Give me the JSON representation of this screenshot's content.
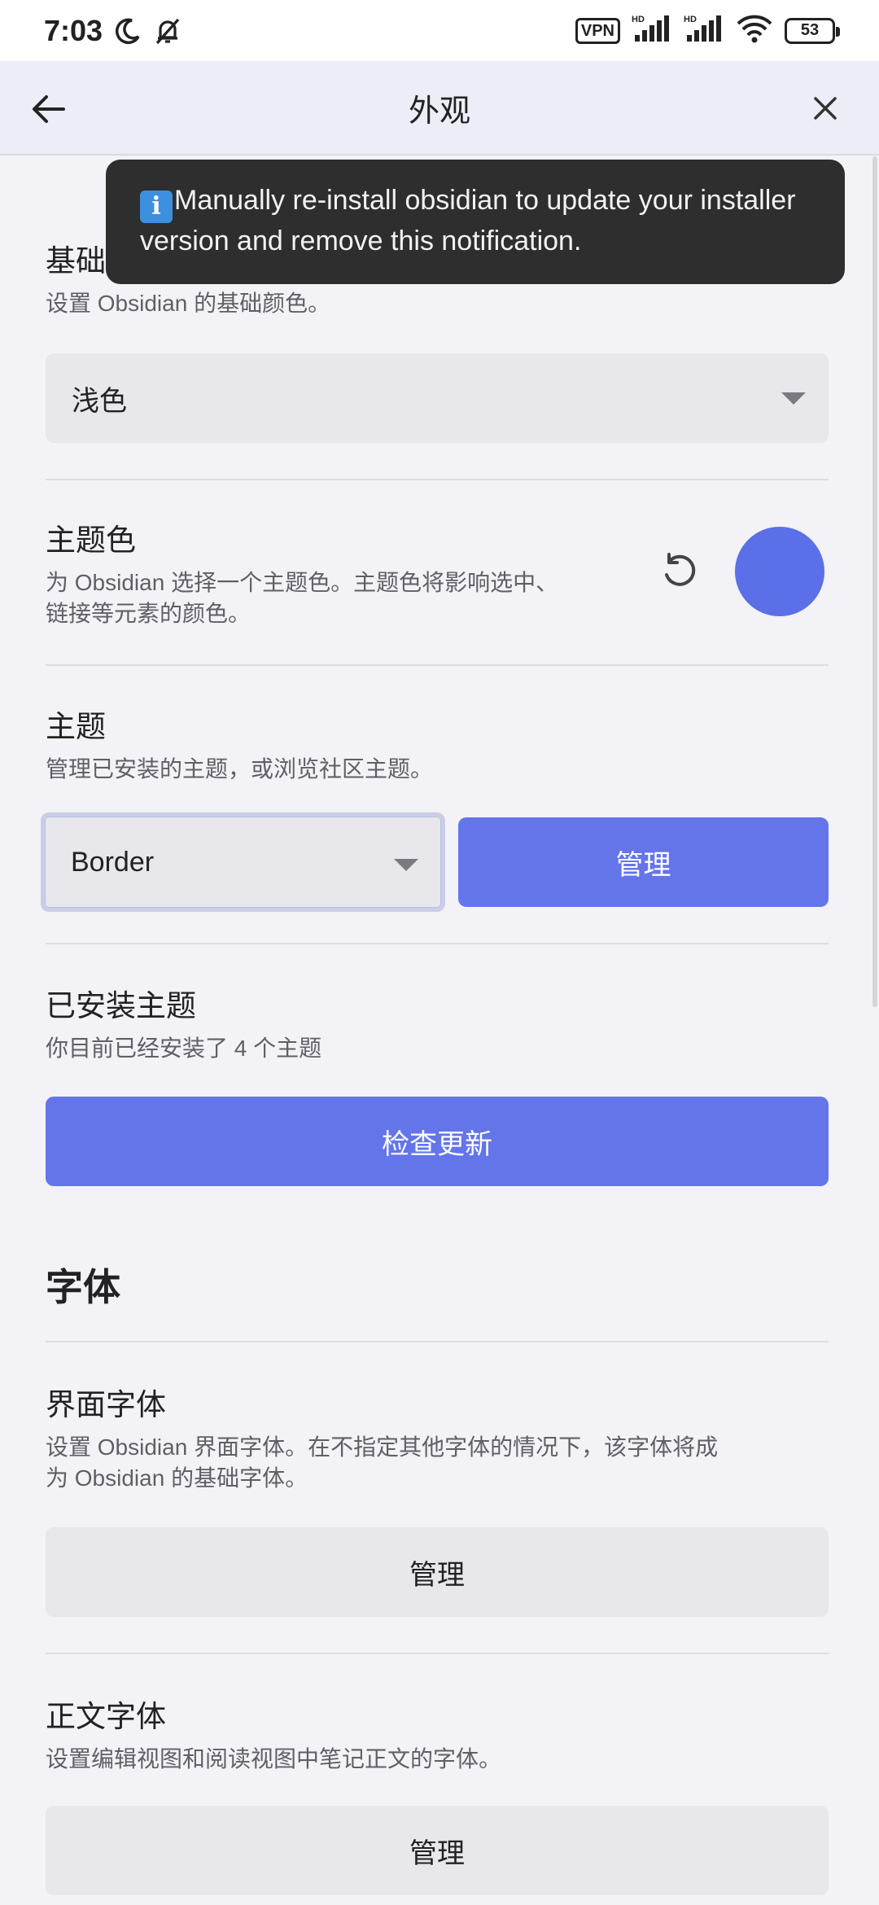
{
  "status_bar": {
    "time": "7:03",
    "vpn_label": "VPN",
    "network_1": "HD",
    "network_2": "HD",
    "battery": "53"
  },
  "header": {
    "title": "外观"
  },
  "toast": {
    "message": "Manually re-install obsidian to update your installer version and remove this notification."
  },
  "settings": {
    "base_color": {
      "name": "基础颜色",
      "desc": "设置 Obsidian 的基础颜色。",
      "selected": "浅色"
    },
    "accent_color": {
      "name": "主题色",
      "desc_line1": "为 Obsidian 选择一个主题色。主题色将影响选中、",
      "desc_line2": "链接等元素的颜色。",
      "color": "#5b6fe8"
    },
    "theme": {
      "name": "主题",
      "desc": "管理已安装的主题，或浏览社区主题。",
      "selected": "Border",
      "manage_label": "管理"
    },
    "installed_themes": {
      "name": "已安装主题",
      "desc": "你目前已经安装了 4 个主题",
      "check_updates_label": "检查更新"
    },
    "fonts_heading": "字体",
    "interface_font": {
      "name": "界面字体",
      "desc_line1": "设置 Obsidian 界面字体。在不指定其他字体的情况下，该字体将成",
      "desc_line2": "为 Obsidian 的基础字体。",
      "manage_label": "管理"
    },
    "text_font": {
      "name": "正文字体",
      "desc": "设置编辑视图和阅读视图中笔记正文的字体。",
      "manage_label": "管理"
    }
  },
  "colors": {
    "accent": "#6475ea",
    "swatch": "#5b6fe8",
    "toast_bg": "#2e2e2e"
  }
}
